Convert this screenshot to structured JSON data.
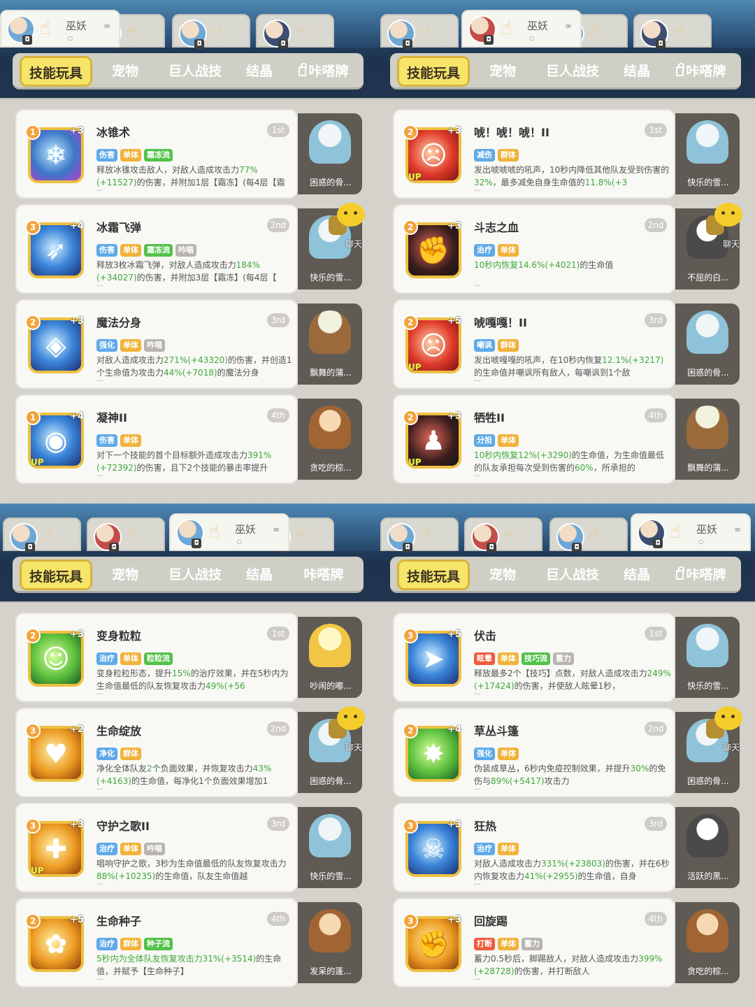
{
  "quadrants": [
    {
      "player_tabs": [
        {
          "name": "巫妖",
          "active": true,
          "dots": "∞",
          "circ": "○"
        },
        {
          "name": "",
          "active": false
        },
        {
          "name": "",
          "active": false
        },
        {
          "name": "",
          "active": false
        }
      ],
      "tabs": [
        "技能玩具",
        "宠物",
        "巨人战技",
        "结晶",
        "咔嗒牌"
      ],
      "locked_last": true,
      "skills": [
        {
          "name": "冰锥术",
          "rank": "1st",
          "lvl": "1",
          "plus": "+3",
          "up": false,
          "tags": [
            [
              "伤害",
              "blue"
            ],
            [
              "单体",
              "orange"
            ],
            [
              "霜冻流",
              "green"
            ]
          ],
          "desc": [
            "释放冰锥攻击敌人，对敌人造成攻击力",
            "77%(+1",
            "1527)",
            "的伤害，并附加1层【霜冻】(每4层【霜"
          ],
          "pet": "困惑的骨...",
          "chat": false
        },
        {
          "name": "冰霜飞弹",
          "rank": "2nd",
          "lvl": "3",
          "plus": "+4",
          "up": false,
          "tags": [
            [
              "伤害",
              "blue"
            ],
            [
              "单体",
              "orange"
            ],
            [
              "霜冻流",
              "green"
            ],
            [
              "吟唱",
              "gray"
            ]
          ],
          "desc": [
            "释放3枚冰霜飞弹，对敌人造成攻击力",
            "184%(+",
            "34027)",
            "的伤害，并附加3层【霜冻】(每4层【"
          ],
          "pet": "快乐的雪...",
          "chat": true
        },
        {
          "name": "魔法分身",
          "rank": "3rd",
          "lvl": "2",
          "plus": "+3",
          "up": false,
          "tags": [
            [
              "强化",
              "blue"
            ],
            [
              "单体",
              "orange"
            ],
            [
              "吟唱",
              "gray"
            ]
          ],
          "desc": [
            "对敌人造成攻击力",
            "271%(+43320)",
            "的伤害，并创造1个生命值为攻击力",
            "44%(+7018)",
            "的魔法分身"
          ],
          "pet": "飘舞的蒲...",
          "chat": false
        },
        {
          "name": "凝神II",
          "rank": "4th",
          "lvl": "1",
          "plus": "+4",
          "up": true,
          "tags": [
            [
              "伤害",
              "blue"
            ],
            [
              "单体",
              "orange"
            ]
          ],
          "desc": [
            "对下一个技能的首个目标额外造成攻击力",
            "391%(+72392)",
            "的伤害，且下2个技能的暴击率提升"
          ],
          "pet": "贪吃的棕...",
          "chat": false
        }
      ]
    },
    {
      "player_tabs": [
        {
          "name": "",
          "active": false
        },
        {
          "name": "巫妖",
          "active": true,
          "dots": "∞",
          "circ": "○"
        },
        {
          "name": "",
          "active": false
        },
        {
          "name": "",
          "active": false
        }
      ],
      "tabs": [
        "技能玩具",
        "宠物",
        "巨人战技",
        "结晶",
        "咔嗒牌"
      ],
      "locked_last": true,
      "skills": [
        {
          "name": "唬！唬！唬！II",
          "rank": "1st",
          "lvl": "2",
          "plus": "+3",
          "up": true,
          "tags": [
            [
              "减伤",
              "blue"
            ],
            [
              "群体",
              "orange"
            ]
          ],
          "desc": [
            "发出唬唬唬的吼声，10秒内降低其他队友受到伤害的",
            "32%",
            "，最多减免自身生命值的",
            "11.8%(+3"
          ],
          "pet": "快乐的雪...",
          "chat": false
        },
        {
          "name": "斗志之血",
          "rank": "2nd",
          "lvl": "2",
          "plus": "+3",
          "up": false,
          "tags": [
            [
              "治疗",
              "blue"
            ],
            [
              "单体",
              "orange"
            ]
          ],
          "desc": [
            "10秒内恢复",
            "14.6%(+4021)",
            "的生命值"
          ],
          "pet": "不屈的白...",
          "chat": true
        },
        {
          "name": "唬嘎嘎！II",
          "rank": "3rd",
          "lvl": "2",
          "plus": "+5",
          "up": true,
          "tags": [
            [
              "嘲讽",
              "blue"
            ],
            [
              "群体",
              "orange"
            ]
          ],
          "desc": [
            "发出唬嘎嘎的吼声，在10秒内恢复",
            "12.1%(+321",
            "7)",
            "的生命值并嘲讽所有敌人，每嘲讽到1个敌"
          ],
          "pet": "困惑的骨...",
          "chat": false
        },
        {
          "name": "牺牲II",
          "rank": "4th",
          "lvl": "2",
          "plus": "+3",
          "up": true,
          "tags": [
            [
              "分担",
              "blue"
            ],
            [
              "单体",
              "orange"
            ]
          ],
          "desc": [
            "10秒内恢复",
            "12%(+3290)",
            "的生命值，为生命值最低的队友承担每次受到伤害的",
            "60%",
            "，所承担的"
          ],
          "pet": "飘舞的蒲...",
          "chat": false
        }
      ]
    },
    {
      "player_tabs": [
        {
          "name": "",
          "active": false
        },
        {
          "name": "",
          "active": false
        },
        {
          "name": "巫妖",
          "active": true,
          "dots": "∞",
          "circ": "○"
        },
        {
          "name": "",
          "active": false
        }
      ],
      "tabs": [
        "技能玩具",
        "宠物",
        "巨人战技",
        "结晶",
        "咔嗒牌"
      ],
      "locked_last": false,
      "skills": [
        {
          "name": "变身粒粒",
          "rank": "1st",
          "lvl": "2",
          "plus": "+3",
          "up": false,
          "tags": [
            [
              "治疗",
              "blue"
            ],
            [
              "单体",
              "orange"
            ],
            [
              "粒粒流",
              "green"
            ]
          ],
          "desc": [
            "变身粒粒形态，提升",
            "15%",
            "的治疗效果，并在5秒内为生命值最低的队友恢复攻击力",
            "49%(+56"
          ],
          "pet": "吵闹的嘟...",
          "chat": false
        },
        {
          "name": "生命绽放",
          "rank": "2nd",
          "lvl": "3",
          "plus": "+2",
          "up": false,
          "tags": [
            [
              "净化",
              "blue"
            ],
            [
              "群体",
              "orange"
            ]
          ],
          "desc": [
            "净化全体队友",
            "2",
            "个负面效果，并恢复攻击力",
            "43%(+4163)",
            "的生命值，每净化1个负面效果增加1"
          ],
          "pet": "困惑的骨...",
          "chat": true
        },
        {
          "name": "守护之歌II",
          "rank": "3rd",
          "lvl": "3",
          "plus": "+3",
          "up": true,
          "tags": [
            [
              "治疗",
              "blue"
            ],
            [
              "单体",
              "orange"
            ],
            [
              "吟唱",
              "gray"
            ]
          ],
          "desc": [
            "唱响守护之歌，3秒为生命值最低的队友恢复攻击力",
            "88%(+10235)",
            "的生命值，队友生命值越"
          ],
          "pet": "快乐的雪...",
          "chat": false
        },
        {
          "name": "生命种子",
          "rank": "4th",
          "lvl": "2",
          "plus": "+5",
          "up": false,
          "tags": [
            [
              "治疗",
              "blue"
            ],
            [
              "群体",
              "orange"
            ],
            [
              "种子流",
              "green"
            ]
          ],
          "desc": [
            "5秒内为全体队友恢复攻击力",
            "31%(+3514)",
            "的生命值，并赋予【生命种子】"
          ],
          "pet": "发呆的蓬...",
          "chat": false
        }
      ]
    },
    {
      "player_tabs": [
        {
          "name": "",
          "active": false
        },
        {
          "name": "",
          "active": false
        },
        {
          "name": "",
          "active": false
        },
        {
          "name": "巫妖",
          "active": true,
          "dots": "∞",
          "circ": "○"
        }
      ],
      "tabs": [
        "技能玩具",
        "宠物",
        "巨人战技",
        "结晶",
        "咔嗒牌"
      ],
      "locked_last": true,
      "skills": [
        {
          "name": "伏击",
          "rank": "1st",
          "lvl": "3",
          "plus": "+5",
          "up": false,
          "tags": [
            [
              "眩晕",
              "red"
            ],
            [
              "单体",
              "orange"
            ],
            [
              "技巧流",
              "green"
            ],
            [
              "蓄力",
              "gray"
            ]
          ],
          "desc": [
            "释放最多2个【技巧】点数，对敌人造成攻击力",
            "249%(+17424)",
            "的伤害，并使敌人眩晕1秒，"
          ],
          "pet": "快乐的雪...",
          "chat": false
        },
        {
          "name": "草丛斗篷",
          "rank": "2nd",
          "lvl": "2",
          "plus": "+4",
          "up": false,
          "tags": [
            [
              "强化",
              "blue"
            ],
            [
              "单体",
              "orange"
            ]
          ],
          "desc": [
            "伪装成草丛，6秒内免疫控制效果，并提升",
            "30%",
            "的免伤与",
            "89%(+5417)",
            "攻击力"
          ],
          "pet": "困惑的骨...",
          "chat": true
        },
        {
          "name": "狂热",
          "rank": "3rd",
          "lvl": "3",
          "plus": "+3",
          "up": false,
          "tags": [
            [
              "治疗",
              "blue"
            ],
            [
              "单体",
              "orange"
            ]
          ],
          "desc": [
            "对敌人造成攻击力",
            "331%(+23803)",
            "的伤害，并在6秒内恢复攻击力",
            "41%(+2955)",
            "的生命值，自身"
          ],
          "pet": "活跃的黑...",
          "chat": false
        },
        {
          "name": "回旋踢",
          "rank": "4th",
          "lvl": "3",
          "plus": "+3",
          "up": false,
          "tags": [
            [
              "打断",
              "red"
            ],
            [
              "单体",
              "orange"
            ],
            [
              "蓄力",
              "gray"
            ]
          ],
          "desc": [
            "蓄力0.5秒后，脚踢敌人，对敌人造成攻击力",
            "399%(+28728)",
            "的伤害，并打断敌人"
          ],
          "pet": "贪吃的棕...",
          "chat": false
        }
      ]
    }
  ],
  "chat_label": "聊天",
  "ellipsis": "...",
  "icon_names": [
    "hand-icon",
    "lock-icon",
    "chat-emoji-icon",
    "skill-icon",
    "pet-icon"
  ],
  "colors": {
    "accent_tab": "#f7e56a",
    "green_value": "#3fa83a",
    "tag_blue": "#5ea9e8",
    "tag_orange": "#f1b23a",
    "tag_green": "#53c24a"
  }
}
